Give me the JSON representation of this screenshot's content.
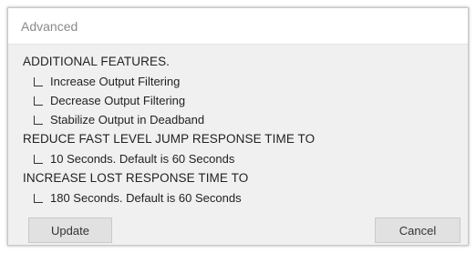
{
  "dialog": {
    "title": "Advanced"
  },
  "sections": {
    "additional": {
      "heading": "ADDITIONAL FEATURES.",
      "options": [
        "Increase Output Filtering",
        "Decrease Output Filtering",
        "Stabilize Output in Deadband"
      ]
    },
    "reduce": {
      "heading": "REDUCE FAST LEVEL JUMP RESPONSE TIME TO",
      "options": [
        "10 Seconds. Default is 60 Seconds"
      ]
    },
    "increase": {
      "heading": "INCREASE LOST RESPONSE TIME TO",
      "options": [
        "180 Seconds. Default is 60 Seconds"
      ]
    }
  },
  "buttons": {
    "update": "Update",
    "cancel": "Cancel"
  }
}
